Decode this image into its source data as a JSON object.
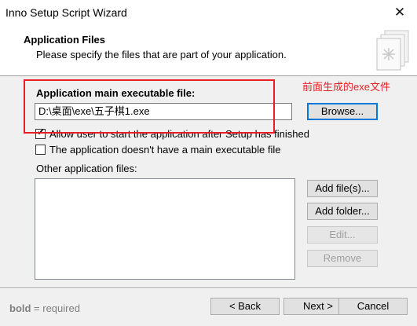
{
  "window": {
    "title": "Inno Setup Script Wizard"
  },
  "header": {
    "title": "Application Files",
    "subtitle": "Please specify the files that are part of your application."
  },
  "main_exe": {
    "label": "Application main executable file:",
    "value": "D:\\桌面\\exe\\五子棋1.exe",
    "browse_label": "Browse..."
  },
  "options": {
    "allow_start": {
      "label": "Allow user to start the application after Setup has finished",
      "checked": true
    },
    "no_main_exe": {
      "label": "The application doesn't have a main executable file",
      "checked": false
    }
  },
  "other_files": {
    "label": "Other application files:",
    "items": [],
    "add_files_label": "Add file(s)...",
    "add_folder_label": "Add folder...",
    "edit_label": "Edit...",
    "remove_label": "Remove"
  },
  "annotation": {
    "text": "前面生成的exe文件",
    "color": "#e81e25"
  },
  "footer": {
    "bold_word": "bold",
    "note_rest": " = required",
    "back_label": "< Back",
    "next_label": "Next >",
    "cancel_label": "Cancel"
  },
  "icons": {
    "close": "close-icon",
    "wizard": "document-stack-icon"
  }
}
